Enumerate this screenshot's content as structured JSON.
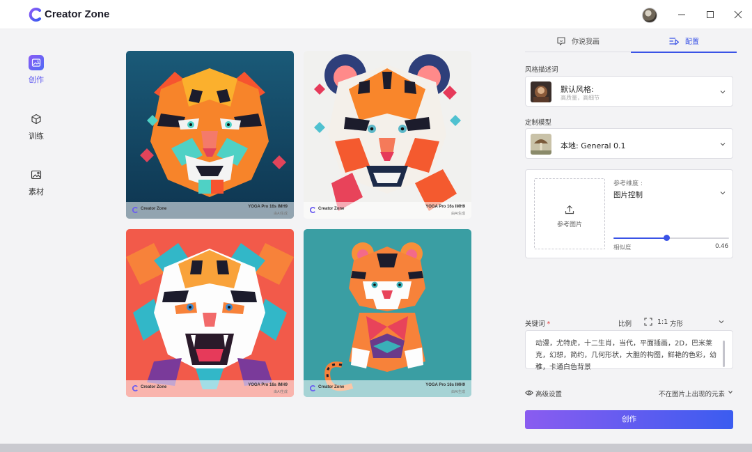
{
  "app": {
    "title": "Creator Zone",
    "accent_color": "#3a53e6",
    "logo_icon": "creator-zone-logo"
  },
  "window": {
    "minimize_icon": "minimize-icon",
    "maximize_icon": "maximize-icon",
    "close_icon": "close-icon"
  },
  "sidebar": {
    "items": [
      {
        "label": "创作",
        "icon": "create-image-icon",
        "active": true
      },
      {
        "label": "训练",
        "icon": "cube-icon",
        "active": false
      },
      {
        "label": "素材",
        "icon": "gallery-icon",
        "active": false
      }
    ]
  },
  "gallery": {
    "images": [
      {
        "subject": "geometric tiger",
        "brand": "Creator Zone",
        "device": "YOGA Pro 16s IMH9",
        "caption": "由AI生成"
      },
      {
        "subject": "geometric tiger",
        "brand": "Creator Zone",
        "device": "YOGA Pro 16s IMH9",
        "caption": "由AI生成"
      },
      {
        "subject": "geometric tiger",
        "brand": "Creator Zone",
        "device": "YOGA Pro 16s IMH9",
        "caption": "由AI生成"
      },
      {
        "subject": "geometric tiger cub",
        "brand": "Creator Zone",
        "device": "YOGA Pro 16s IMH9",
        "caption": "由AI生成"
      }
    ]
  },
  "panel": {
    "tabs": [
      {
        "label": "你说我画",
        "icon": "chat-draw-icon",
        "active": false
      },
      {
        "label": "配置",
        "icon": "config-icon",
        "active": true
      }
    ],
    "style": {
      "label": "风格描述词",
      "value": "默认风格:",
      "subtitle": "高质量，高细节"
    },
    "model": {
      "label": "定制模型",
      "value": "本地: General 0.1"
    },
    "reference": {
      "upload_label": "参考图片",
      "dimension_label": "参考维度 :",
      "dimension_value": "图片控制",
      "similarity_label": "相似度",
      "similarity_value": "0.46",
      "similarity": 0.46
    },
    "keywords": {
      "label": "关键词",
      "required_mark": "*",
      "text": "动漫，尤特虎，十二生肖，当代，平面插画，2D，巴米莱克，幻想，简约，几何形状，大胆的构图，鲜艳的色彩，幼稚，卡通白色背景"
    },
    "ratio": {
      "label": "比例",
      "value": "1:1",
      "shape": "方形"
    },
    "advanced": {
      "label": "高级设置",
      "negative_label": "不在图片上出现的元素"
    },
    "create_button": "创作"
  }
}
